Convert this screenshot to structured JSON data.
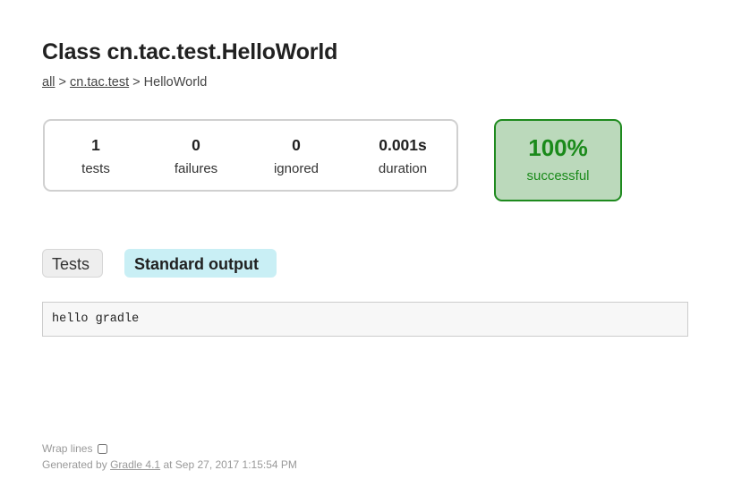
{
  "page": {
    "title": "Class cn.tac.test.HelloWorld"
  },
  "breadcrumbs": {
    "items": [
      {
        "label": "all",
        "link": true
      },
      {
        "label": "cn.tac.test",
        "link": true
      },
      {
        "label": "HelloWorld",
        "link": false
      }
    ],
    "separator": ">"
  },
  "summary": {
    "counters": [
      {
        "value": "1",
        "label": "tests"
      },
      {
        "value": "0",
        "label": "failures"
      },
      {
        "value": "0",
        "label": "ignored"
      },
      {
        "value": "0.001s",
        "label": "duration"
      }
    ],
    "success_rate": {
      "value": "100%",
      "label": "successful",
      "percent": 100,
      "color": "#1a8a1a",
      "background": "#bbd9bb"
    }
  },
  "tabs": [
    {
      "label": "Tests",
      "selected": false
    },
    {
      "label": "Standard output",
      "selected": true
    }
  ],
  "output": {
    "text": "hello gradle"
  },
  "footer": {
    "wrap_lines_label": "Wrap lines",
    "wrap_lines_checked": false,
    "generated_prefix": "Generated by ",
    "generator_link": "Gradle 4.1",
    "generated_suffix": " at Sep 27, 2017 1:15:54 PM"
  }
}
